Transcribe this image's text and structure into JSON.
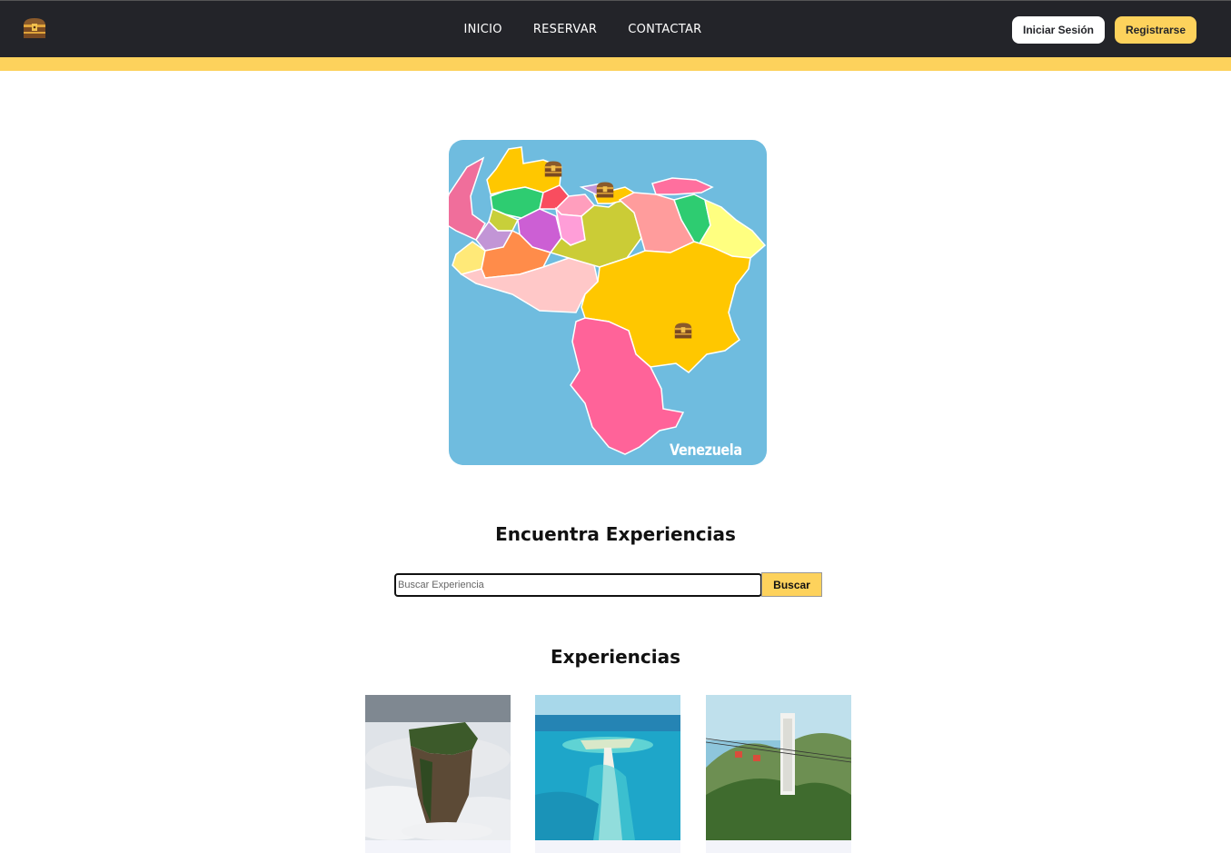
{
  "navbar": {
    "logo_icon": "treasure-chest-icon",
    "links": [
      {
        "label": "INICIO"
      },
      {
        "label": "RESERVAR"
      },
      {
        "label": "CONTACTAR"
      }
    ],
    "login_label": "Iniciar Sesión",
    "register_label": "Registrarse"
  },
  "colors": {
    "navbar_bg": "#232429",
    "accent": "#fdd25c",
    "map_water": "#6fbcdf"
  },
  "map": {
    "label": "Venezuela",
    "marker_icon": "treasure-chest-icon"
  },
  "search": {
    "title": "Encuentra Experiencias",
    "placeholder": "Buscar Experiencia",
    "button_label": "Buscar"
  },
  "experiences": {
    "title": "Experiencias",
    "cards": [
      {
        "image": "tepui-above-clouds"
      },
      {
        "image": "caribbean-island-sandbar"
      },
      {
        "image": "mountain-cable-car-tower"
      }
    ]
  }
}
